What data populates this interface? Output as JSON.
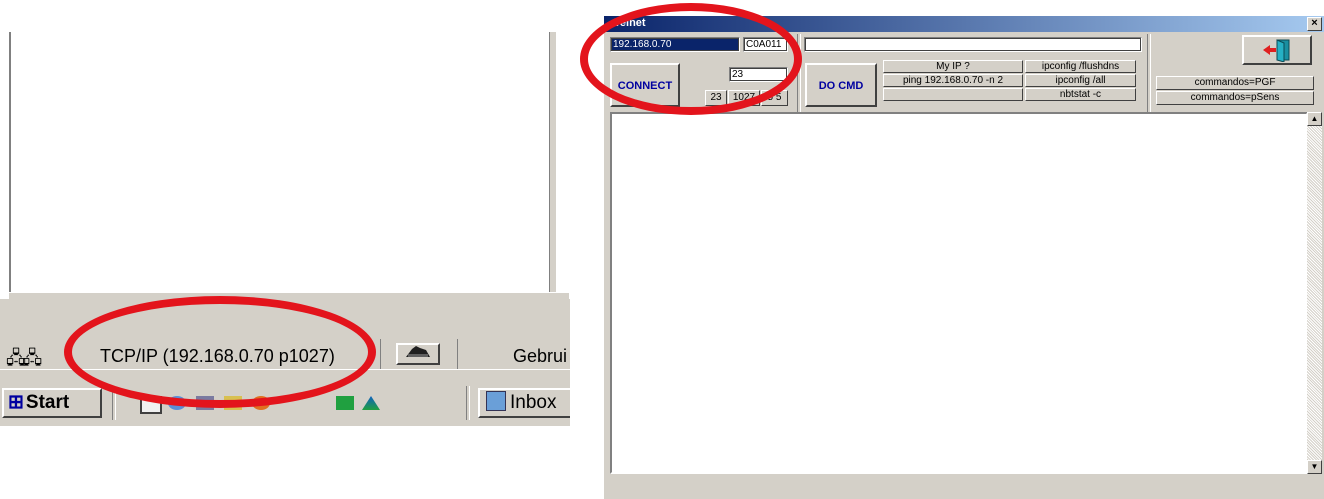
{
  "left_panel": {
    "status_text": "TCP/IP (192.168.0.70 p1027)",
    "status_user": "Gebrui",
    "network_icon": "network-computers-icon",
    "status_button_icon": "modem-icon",
    "start_label": "Start",
    "inbox_label": "Inbox"
  },
  "telnet": {
    "title": "Telnet",
    "close_label": "×",
    "ip_value": "192.168.0.70",
    "code_value": "C0A011",
    "connect_label": "CONNECT",
    "port_value": "23",
    "port_buttons": [
      "23",
      "1027",
      "5 5"
    ],
    "command_value": "",
    "docmd_label": "DO CMD",
    "quick_buttons_col1": [
      "My IP ?",
      "ping 192.168.0.70 -n 2",
      ""
    ],
    "quick_buttons_col2": [
      "ipconfig /flushdns",
      "ipconfig /all",
      "nbtstat -c"
    ],
    "exit_icon": "exit-door-icon",
    "pgf_label": "commandos=PGF",
    "psens_label": "commandos=pSens",
    "scroll_up": "▲",
    "scroll_down": "▼"
  },
  "colors": {
    "annotation": "#e3141c",
    "titlebar": "#0a246a",
    "button_text": "#0000a0"
  }
}
